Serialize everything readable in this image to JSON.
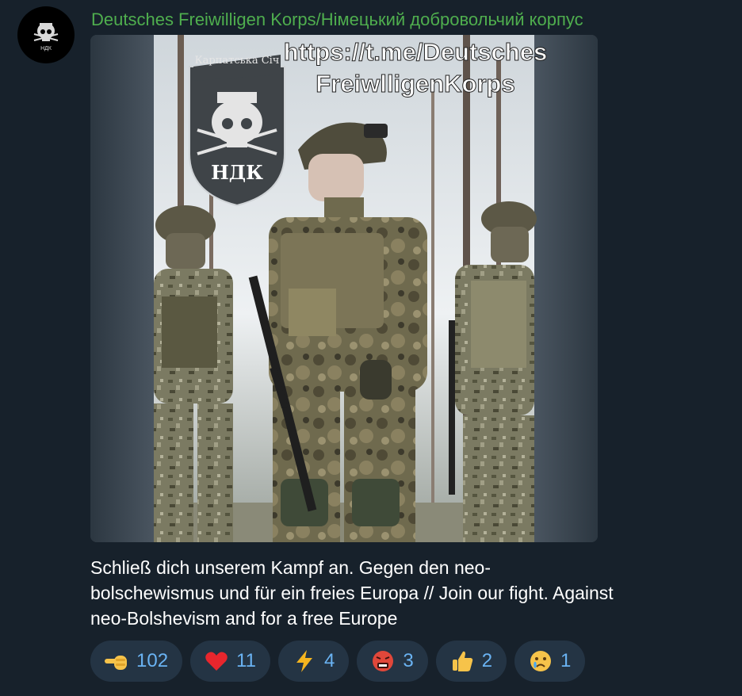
{
  "channel": {
    "name": "Deutsches Freiwilligen Korps/Німецький добровольчий корпус",
    "avatar_text": "НДК"
  },
  "photo": {
    "patch_top": "Карпатська Січ",
    "patch_bottom": "НДК",
    "overlay_line1": "https://t.me/Deutsches",
    "overlay_line2": "FreiwlligenKorps"
  },
  "message": {
    "text": "Schließ dich unserem Kampf an. Gegen den neo-bolschewismus und für ein freies Europa // Join our fight. Against neo-Bolshevism and for a free Europe"
  },
  "reactions": [
    {
      "icon": "pointing-hand-icon",
      "count": "102"
    },
    {
      "icon": "heart-icon",
      "count": "11"
    },
    {
      "icon": "lightning-icon",
      "count": "4"
    },
    {
      "icon": "angry-face-icon",
      "count": "3"
    },
    {
      "icon": "thumbs-up-icon",
      "count": "2"
    },
    {
      "icon": "crying-face-icon",
      "count": "1"
    }
  ],
  "colors": {
    "background": "#17212b",
    "sender": "#4fae4e",
    "reaction_bg": "#243444",
    "reaction_count": "#6ab3f3"
  }
}
